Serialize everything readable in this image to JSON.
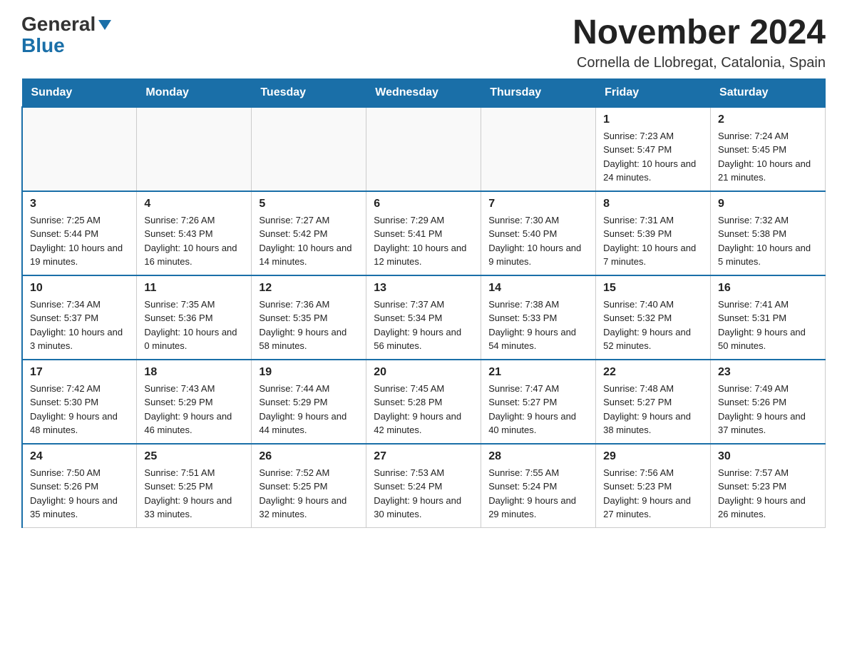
{
  "header": {
    "logo_general": "General",
    "logo_blue": "Blue",
    "main_title": "November 2024",
    "subtitle": "Cornella de Llobregat, Catalonia, Spain"
  },
  "days_of_week": [
    "Sunday",
    "Monday",
    "Tuesday",
    "Wednesday",
    "Thursday",
    "Friday",
    "Saturday"
  ],
  "weeks": [
    [
      {
        "day": "",
        "info": ""
      },
      {
        "day": "",
        "info": ""
      },
      {
        "day": "",
        "info": ""
      },
      {
        "day": "",
        "info": ""
      },
      {
        "day": "",
        "info": ""
      },
      {
        "day": "1",
        "info": "Sunrise: 7:23 AM\nSunset: 5:47 PM\nDaylight: 10 hours and 24 minutes."
      },
      {
        "day": "2",
        "info": "Sunrise: 7:24 AM\nSunset: 5:45 PM\nDaylight: 10 hours and 21 minutes."
      }
    ],
    [
      {
        "day": "3",
        "info": "Sunrise: 7:25 AM\nSunset: 5:44 PM\nDaylight: 10 hours and 19 minutes."
      },
      {
        "day": "4",
        "info": "Sunrise: 7:26 AM\nSunset: 5:43 PM\nDaylight: 10 hours and 16 minutes."
      },
      {
        "day": "5",
        "info": "Sunrise: 7:27 AM\nSunset: 5:42 PM\nDaylight: 10 hours and 14 minutes."
      },
      {
        "day": "6",
        "info": "Sunrise: 7:29 AM\nSunset: 5:41 PM\nDaylight: 10 hours and 12 minutes."
      },
      {
        "day": "7",
        "info": "Sunrise: 7:30 AM\nSunset: 5:40 PM\nDaylight: 10 hours and 9 minutes."
      },
      {
        "day": "8",
        "info": "Sunrise: 7:31 AM\nSunset: 5:39 PM\nDaylight: 10 hours and 7 minutes."
      },
      {
        "day": "9",
        "info": "Sunrise: 7:32 AM\nSunset: 5:38 PM\nDaylight: 10 hours and 5 minutes."
      }
    ],
    [
      {
        "day": "10",
        "info": "Sunrise: 7:34 AM\nSunset: 5:37 PM\nDaylight: 10 hours and 3 minutes."
      },
      {
        "day": "11",
        "info": "Sunrise: 7:35 AM\nSunset: 5:36 PM\nDaylight: 10 hours and 0 minutes."
      },
      {
        "day": "12",
        "info": "Sunrise: 7:36 AM\nSunset: 5:35 PM\nDaylight: 9 hours and 58 minutes."
      },
      {
        "day": "13",
        "info": "Sunrise: 7:37 AM\nSunset: 5:34 PM\nDaylight: 9 hours and 56 minutes."
      },
      {
        "day": "14",
        "info": "Sunrise: 7:38 AM\nSunset: 5:33 PM\nDaylight: 9 hours and 54 minutes."
      },
      {
        "day": "15",
        "info": "Sunrise: 7:40 AM\nSunset: 5:32 PM\nDaylight: 9 hours and 52 minutes."
      },
      {
        "day": "16",
        "info": "Sunrise: 7:41 AM\nSunset: 5:31 PM\nDaylight: 9 hours and 50 minutes."
      }
    ],
    [
      {
        "day": "17",
        "info": "Sunrise: 7:42 AM\nSunset: 5:30 PM\nDaylight: 9 hours and 48 minutes."
      },
      {
        "day": "18",
        "info": "Sunrise: 7:43 AM\nSunset: 5:29 PM\nDaylight: 9 hours and 46 minutes."
      },
      {
        "day": "19",
        "info": "Sunrise: 7:44 AM\nSunset: 5:29 PM\nDaylight: 9 hours and 44 minutes."
      },
      {
        "day": "20",
        "info": "Sunrise: 7:45 AM\nSunset: 5:28 PM\nDaylight: 9 hours and 42 minutes."
      },
      {
        "day": "21",
        "info": "Sunrise: 7:47 AM\nSunset: 5:27 PM\nDaylight: 9 hours and 40 minutes."
      },
      {
        "day": "22",
        "info": "Sunrise: 7:48 AM\nSunset: 5:27 PM\nDaylight: 9 hours and 38 minutes."
      },
      {
        "day": "23",
        "info": "Sunrise: 7:49 AM\nSunset: 5:26 PM\nDaylight: 9 hours and 37 minutes."
      }
    ],
    [
      {
        "day": "24",
        "info": "Sunrise: 7:50 AM\nSunset: 5:26 PM\nDaylight: 9 hours and 35 minutes."
      },
      {
        "day": "25",
        "info": "Sunrise: 7:51 AM\nSunset: 5:25 PM\nDaylight: 9 hours and 33 minutes."
      },
      {
        "day": "26",
        "info": "Sunrise: 7:52 AM\nSunset: 5:25 PM\nDaylight: 9 hours and 32 minutes."
      },
      {
        "day": "27",
        "info": "Sunrise: 7:53 AM\nSunset: 5:24 PM\nDaylight: 9 hours and 30 minutes."
      },
      {
        "day": "28",
        "info": "Sunrise: 7:55 AM\nSunset: 5:24 PM\nDaylight: 9 hours and 29 minutes."
      },
      {
        "day": "29",
        "info": "Sunrise: 7:56 AM\nSunset: 5:23 PM\nDaylight: 9 hours and 27 minutes."
      },
      {
        "day": "30",
        "info": "Sunrise: 7:57 AM\nSunset: 5:23 PM\nDaylight: 9 hours and 26 minutes."
      }
    ]
  ]
}
